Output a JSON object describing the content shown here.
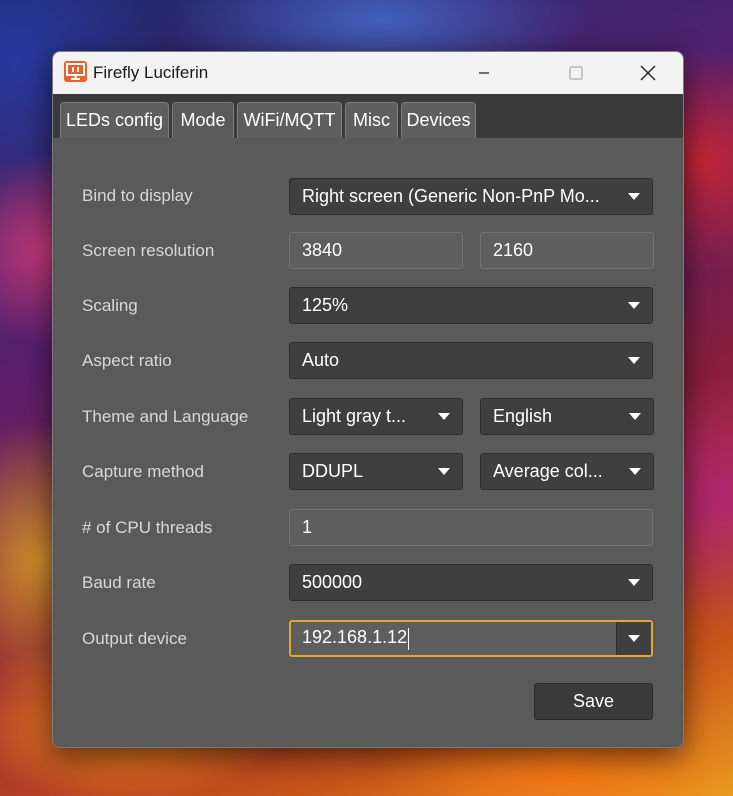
{
  "window": {
    "title": "Firefly Luciferin",
    "controls": {
      "minimize": "minimize-icon",
      "maximize": "maximize-icon",
      "close": "close-icon"
    }
  },
  "tabs": [
    {
      "label": "LEDs config",
      "active": false
    },
    {
      "label": "Mode",
      "active": true
    },
    {
      "label": "WiFi/MQTT",
      "active": false
    },
    {
      "label": "Misc",
      "active": false
    },
    {
      "label": "Devices",
      "active": false
    }
  ],
  "form": {
    "bind_display": {
      "label": "Bind to display",
      "value": "Right screen (Generic Non-PnP Mo..."
    },
    "screen_resolution": {
      "label": "Screen resolution",
      "width": "3840",
      "height": "2160"
    },
    "scaling": {
      "label": "Scaling",
      "value": "125%"
    },
    "aspect_ratio": {
      "label": "Aspect ratio",
      "value": "Auto"
    },
    "theme_language": {
      "label": "Theme and Language",
      "theme": "Light gray t...",
      "language": "English"
    },
    "capture_method": {
      "label": "Capture method",
      "method": "DDUPL",
      "color_mode": "Average col..."
    },
    "cpu_threads": {
      "label": "# of CPU threads",
      "value": "1"
    },
    "baud_rate": {
      "label": "Baud rate",
      "value": "500000"
    },
    "output_device": {
      "label": "Output device",
      "value": "192.168.1.12"
    }
  },
  "actions": {
    "save_label": "Save"
  },
  "colors": {
    "accent_focus": "#e3a633",
    "app_icon": "#e8612c",
    "window_bg": "#5a5a5a"
  }
}
